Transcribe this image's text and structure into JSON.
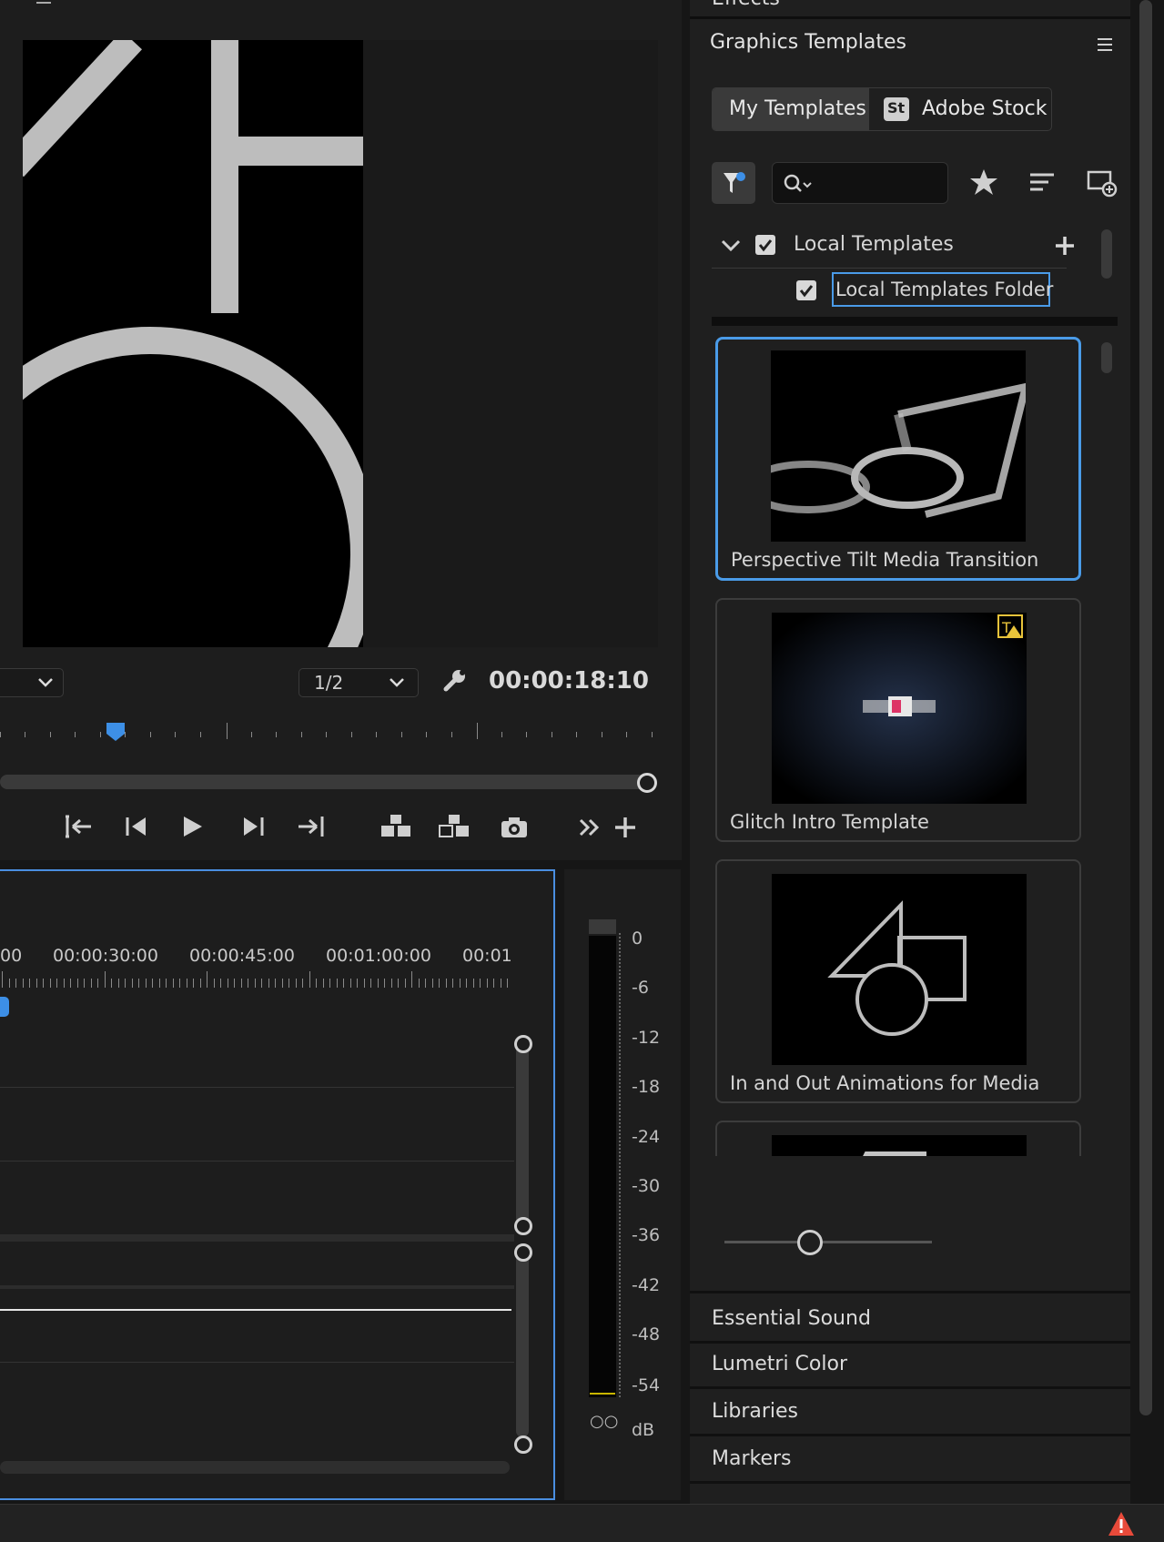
{
  "program_monitor": {
    "zoom_select": "",
    "resolution_select": "1/2",
    "timecode": "00:00:18:10"
  },
  "timeline": {
    "ruler_labels": [
      "00",
      "00:00:30:00",
      "00:00:45:00",
      "00:01:00:00",
      "00:01"
    ]
  },
  "audio_meter": {
    "scale": [
      "0",
      "-6",
      "-12",
      "-18",
      "-24",
      "-30",
      "-36",
      "-42",
      "-48",
      "-54",
      "dB"
    ],
    "solo_labels": "○○"
  },
  "right_panel": {
    "top_section": "Effects",
    "title": "Graphics Templates",
    "tabs": [
      {
        "label": "My Templates"
      },
      {
        "label": "Adobe Stock",
        "badge": "St"
      }
    ],
    "search": {
      "placeholder": ""
    },
    "filter_tree": {
      "root_label": "Local Templates",
      "child_label": "Local Templates Folder"
    },
    "templates": [
      {
        "name": "Perspective Tilt Media Transition"
      },
      {
        "name": "Glitch Intro Template"
      },
      {
        "name": "In and Out Animations for Media"
      },
      {
        "name": ""
      }
    ],
    "sections": [
      "Essential Sound",
      "Lumetri Color",
      "Libraries",
      "Markers"
    ]
  },
  "colors": {
    "accent": "#4a9be8",
    "warning": "#e84a3a",
    "badge_yellow": "#e8c33a"
  }
}
